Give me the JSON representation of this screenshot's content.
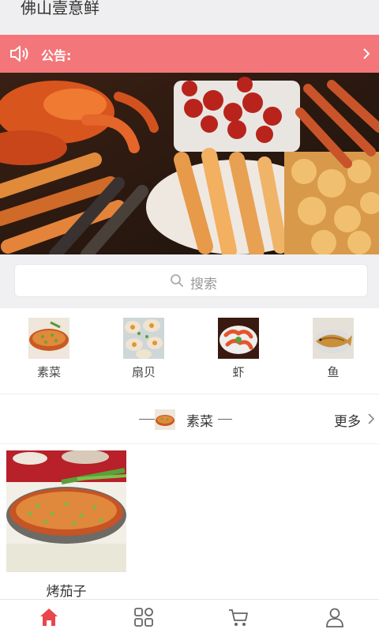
{
  "app": {
    "title": "佛山壹意鲜"
  },
  "notice": {
    "label": "公告:"
  },
  "banner": {
    "active_slide": 1,
    "slide_count": 2
  },
  "search": {
    "placeholder": "搜索"
  },
  "categories": [
    {
      "name": "素菜",
      "icon": "eggplant-dish-thumbnail"
    },
    {
      "name": "扇贝",
      "icon": "scallop-thumbnail"
    },
    {
      "name": "虾",
      "icon": "shrimp-thumbnail"
    },
    {
      "name": "鱼",
      "icon": "fish-thumbnail"
    }
  ],
  "section": {
    "title": "素菜",
    "more": "更多"
  },
  "products": [
    {
      "name": "烤茄子",
      "icon": "grilled-eggplant-photo"
    }
  ],
  "tabbar": {
    "items": [
      {
        "icon": "home-icon",
        "active": true
      },
      {
        "icon": "category-grid-icon",
        "active": false
      },
      {
        "icon": "cart-icon",
        "active": false
      },
      {
        "icon": "user-icon",
        "active": false
      }
    ]
  },
  "colors": {
    "notice_bg": "#f3777a",
    "accent": "#e8474c",
    "dot_active": "#2f9df4"
  }
}
